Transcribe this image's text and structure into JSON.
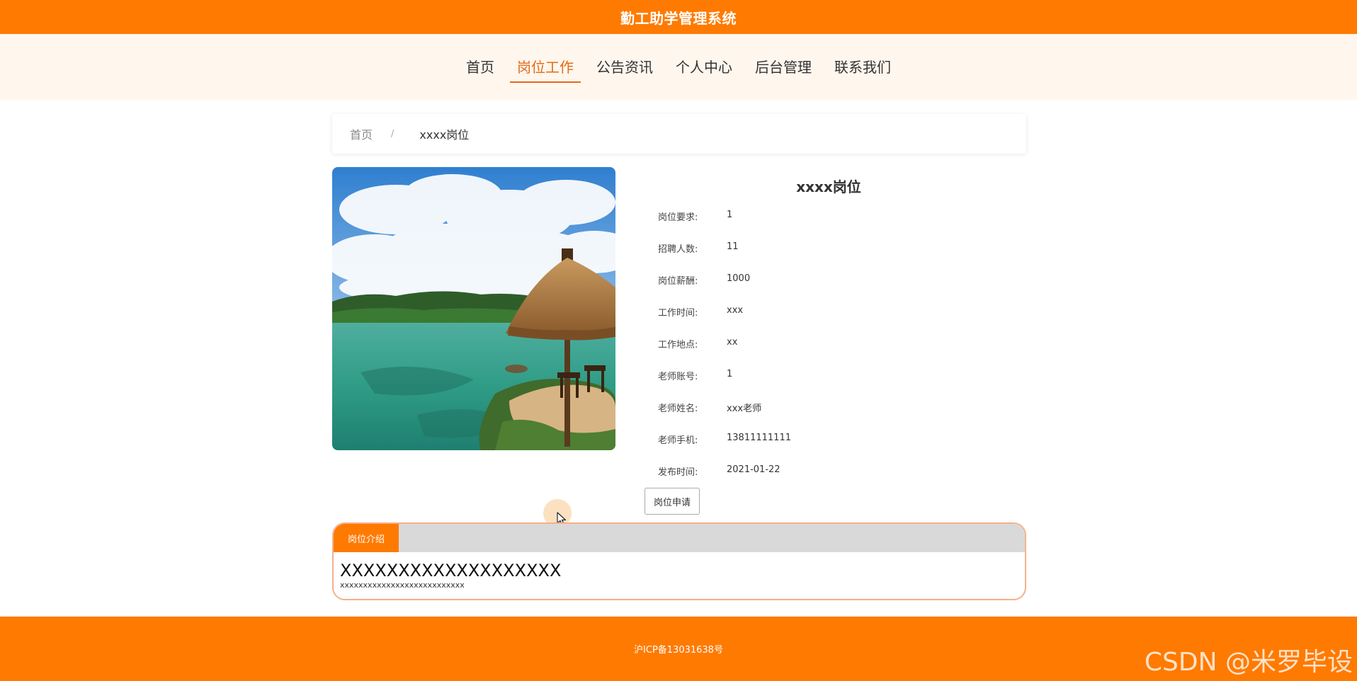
{
  "header": {
    "title": "勤工助学管理系统"
  },
  "nav": {
    "items": [
      {
        "label": "首页"
      },
      {
        "label": "岗位工作",
        "active": true
      },
      {
        "label": "公告资讯"
      },
      {
        "label": "个人中心"
      },
      {
        "label": "后台管理"
      },
      {
        "label": "联系我们"
      }
    ]
  },
  "breadcrumb": {
    "home": "首页",
    "separator": "/",
    "current": "xxxx岗位"
  },
  "detail": {
    "title": "xxxx岗位",
    "rows": [
      {
        "label": "岗位要求:",
        "value": "1"
      },
      {
        "label": "招聘人数:",
        "value": "11"
      },
      {
        "label": "岗位薪酬:",
        "value": "1000"
      },
      {
        "label": "工作时间:",
        "value": "xxx"
      },
      {
        "label": "工作地点:",
        "value": "xx"
      },
      {
        "label": "老师账号:",
        "value": "1"
      },
      {
        "label": "老师姓名:",
        "value": "xxx老师"
      },
      {
        "label": "老师手机:",
        "value": "13811111111"
      },
      {
        "label": "发布时间:",
        "value": "2021-01-22"
      }
    ],
    "apply_label": "岗位申请"
  },
  "intro": {
    "tab_label": "岗位介绍",
    "heading": "XXXXXXXXXXXXXXXXXXX",
    "text": "xxxxxxxxxxxxxxxxxxxxxxxxxxx"
  },
  "footer": {
    "icp": "沪ICP备13031638号"
  },
  "watermark": "CSDN @米罗毕设",
  "colors": {
    "brand": "#ff7a00",
    "nav_band": "#fff6ee",
    "active_nav": "#e26a14"
  },
  "icons": {
    "cursor": "mouse-pointer-icon"
  }
}
